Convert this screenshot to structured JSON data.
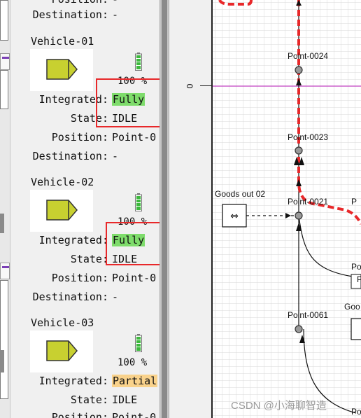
{
  "top_partial": {
    "position_label": "Position:",
    "position_value": "-",
    "destination_label": "Destination:",
    "destination_value": "-"
  },
  "vehicles": [
    {
      "name": "Vehicle-01",
      "battery": "100 %",
      "integrated_label": "Integrated:",
      "integrated_value": "Fully",
      "integrated_color": "#7edc6b",
      "state_label": "State:",
      "state_value": "IDLE",
      "position_label": "Position:",
      "position_value": "Point-0",
      "destination_label": "Destination:",
      "destination_value": "-"
    },
    {
      "name": "Vehicle-02",
      "battery": "100 %",
      "integrated_label": "Integrated:",
      "integrated_value": "Fully",
      "integrated_color": "#7edc6b",
      "state_label": "State:",
      "state_value": "IDLE",
      "position_label": "Position:",
      "position_value": "Point-0",
      "destination_label": "Destination:",
      "destination_value": "-"
    },
    {
      "name": "Vehicle-03",
      "battery": "100 %",
      "integrated_label": "Integrated:",
      "integrated_value": "Partial",
      "integrated_color": "#f9d28b",
      "state_label": "State:",
      "state_value": "IDLE",
      "position_label": "Position:",
      "position_value": "Point-0"
    }
  ],
  "ruler": {
    "zero_label": "0"
  },
  "map": {
    "points": [
      "Point-0024",
      "Point-0023",
      "Point-0021",
      "Point-0061"
    ],
    "location": "Goods out 02",
    "edge_labels": [
      "P",
      "Po",
      "Po",
      "Goo",
      "Po"
    ]
  },
  "watermark": "CSDN @小海聊智造",
  "colors": {
    "route": "#e8282a",
    "highlight_box": "#e8282a",
    "vehicle_body": "#c8d030",
    "axis_line": "#c040c0"
  }
}
